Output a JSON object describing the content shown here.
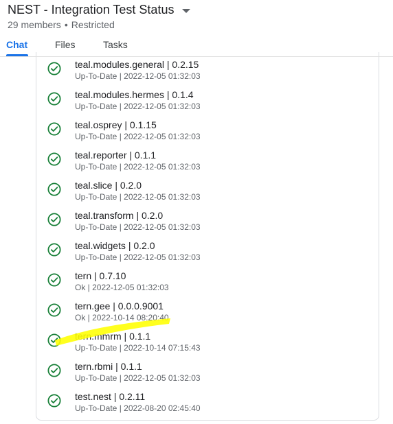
{
  "header": {
    "title": "NEST - Integration Test Status",
    "members": "29 members",
    "separator": "•",
    "access": "Restricted"
  },
  "tabs": [
    {
      "label": "Chat",
      "active": true
    },
    {
      "label": "Files",
      "active": false
    },
    {
      "label": "Tasks",
      "active": false
    }
  ],
  "colors": {
    "accent": "#1a73e8",
    "success": "#188038",
    "highlight": "#ffff00"
  },
  "packages": [
    {
      "name": "teal.modules.general | 0.2.15",
      "status": "Up-To-Date | 2022-12-05 01:32:03",
      "icon": "check-circle-icon"
    },
    {
      "name": "teal.modules.hermes | 0.1.4",
      "status": "Up-To-Date | 2022-12-05 01:32:03",
      "icon": "check-circle-icon"
    },
    {
      "name": "teal.osprey | 0.1.15",
      "status": "Up-To-Date | 2022-12-05 01:32:03",
      "icon": "check-circle-icon"
    },
    {
      "name": "teal.reporter | 0.1.1",
      "status": "Up-To-Date | 2022-12-05 01:32:03",
      "icon": "check-circle-icon"
    },
    {
      "name": "teal.slice | 0.2.0",
      "status": "Up-To-Date | 2022-12-05 01:32:03",
      "icon": "check-circle-icon"
    },
    {
      "name": "teal.transform | 0.2.0",
      "status": "Up-To-Date | 2022-12-05 01:32:03",
      "icon": "check-circle-icon"
    },
    {
      "name": "teal.widgets | 0.2.0",
      "status": "Up-To-Date | 2022-12-05 01:32:03",
      "icon": "check-circle-icon"
    },
    {
      "name": "tern | 0.7.10",
      "status": "Ok | 2022-12-05 01:32:03",
      "icon": "check-circle-icon"
    },
    {
      "name": "tern.gee | 0.0.0.9001",
      "status": "Ok | 2022-10-14 08:20:40",
      "icon": "check-circle-icon"
    },
    {
      "name": "tern.mmrm | 0.1.1",
      "status": "Up-To-Date | 2022-10-14 07:15:43",
      "icon": "check-circle-icon"
    },
    {
      "name": "tern.rbmi | 0.1.1",
      "status": "Up-To-Date | 2022-12-05 01:32:03",
      "icon": "check-circle-icon"
    },
    {
      "name": "test.nest | 0.2.11",
      "status": "Up-To-Date | 2022-08-20 02:45:40",
      "icon": "check-circle-icon"
    }
  ]
}
